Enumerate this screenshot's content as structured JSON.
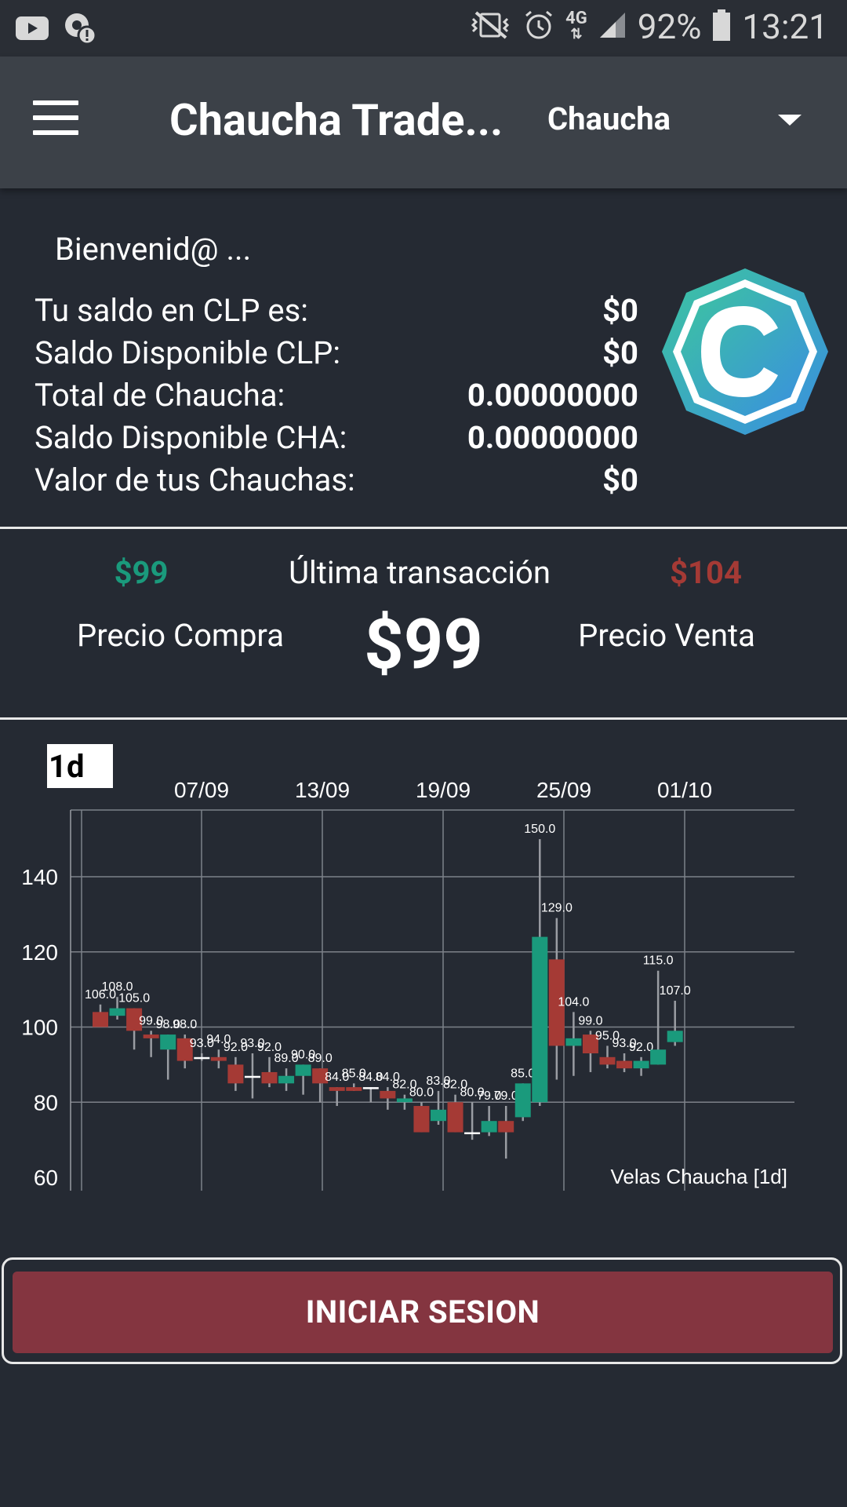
{
  "status_bar": {
    "battery": "92%",
    "time": "13:21",
    "network": "4G",
    "left_icons": [
      "youtube-icon",
      "settings-alert-icon"
    ],
    "right_icons": [
      "mute-vibrate-icon",
      "alarm-icon",
      "4g-icon",
      "signal-icon",
      "battery-icon"
    ]
  },
  "toolbar": {
    "title": "Chaucha Trade...",
    "spinner_value": "Chaucha"
  },
  "welcome": "Bienvenid@ ...",
  "balances": [
    {
      "label": "Tu saldo en CLP es:",
      "value": "$0"
    },
    {
      "label": "Saldo Disponible CLP:",
      "value": "$0"
    },
    {
      "label": "Total de Chaucha:",
      "value": "0.00000000"
    },
    {
      "label": "Saldo Disponible CHA:",
      "value": "0.00000000"
    },
    {
      "label": "Valor de tus Chauchas:",
      "value": "$0"
    }
  ],
  "prices": {
    "buy_value": "$99",
    "sell_value": "$104",
    "last_label": "Última transacción",
    "buy_label": "Precio Compra",
    "sell_label": "Precio Venta",
    "last_value": "$99"
  },
  "timeframe": "1d",
  "login_button": "INICIAR SESION",
  "colors": {
    "up": "#1a9a7c",
    "down": "#a53a35",
    "background": "#252a33",
    "toolbar": "#3c4148",
    "button": "#843540"
  },
  "chart_data": {
    "type": "candlestick",
    "title": "Velas Chaucha [1d]",
    "x_ticks": [
      "07/09",
      "13/09",
      "19/09",
      "25/09",
      "01/10"
    ],
    "ylim": [
      60,
      150
    ],
    "y_ticks": [
      60,
      80,
      100,
      120,
      140
    ],
    "grid": true,
    "candles": [
      {
        "open": 104,
        "close": 100,
        "high": 106,
        "low": 100,
        "label": "106.0"
      },
      {
        "open": 103,
        "close": 105,
        "high": 108,
        "low": 102,
        "label": "108.0"
      },
      {
        "open": 105,
        "close": 99,
        "high": 105,
        "low": 94,
        "label": "105.0"
      },
      {
        "open": 98,
        "close": 97,
        "high": 99,
        "low": 92,
        "label": "99.0"
      },
      {
        "open": 94,
        "close": 98,
        "high": 98,
        "low": 86,
        "label": "98.0"
      },
      {
        "open": 97,
        "close": 91,
        "high": 98,
        "low": 89,
        "label": "98.0"
      },
      {
        "open": 92,
        "close": 92,
        "high": 93,
        "low": 91,
        "label": "93.0"
      },
      {
        "open": 92,
        "close": 91,
        "high": 94,
        "low": 89,
        "label": "94.0"
      },
      {
        "open": 90,
        "close": 85,
        "high": 92,
        "low": 83,
        "label": "92.0"
      },
      {
        "open": 87,
        "close": 87,
        "high": 93,
        "low": 81,
        "label": "93.0"
      },
      {
        "open": 88,
        "close": 85,
        "high": 92,
        "low": 84,
        "label": "92.0"
      },
      {
        "open": 85,
        "close": 87,
        "high": 89,
        "low": 83,
        "label": "89.0"
      },
      {
        "open": 87,
        "close": 90,
        "high": 90,
        "low": 82,
        "label": "90.0"
      },
      {
        "open": 89,
        "close": 85,
        "high": 89,
        "low": 80,
        "label": "89.0"
      },
      {
        "open": 84,
        "close": 83,
        "high": 84,
        "low": 79,
        "label": "84.0"
      },
      {
        "open": 84,
        "close": 83,
        "high": 85,
        "low": 83,
        "label": "85.0"
      },
      {
        "open": 84,
        "close": 84,
        "high": 84,
        "low": 80,
        "label": "84.0"
      },
      {
        "open": 83,
        "close": 81,
        "high": 84,
        "low": 78,
        "label": "84.0"
      },
      {
        "open": 80,
        "close": 81,
        "high": 82,
        "low": 78,
        "label": "82.0"
      },
      {
        "open": 79,
        "close": 72,
        "high": 80,
        "low": 72,
        "label": "80.0"
      },
      {
        "open": 75,
        "close": 78,
        "high": 83,
        "low": 74,
        "label": "83.0"
      },
      {
        "open": 80,
        "close": 72,
        "high": 82,
        "low": 72,
        "label": "82.0"
      },
      {
        "open": 72,
        "close": 72,
        "high": 80,
        "low": 70,
        "label": "80.0"
      },
      {
        "open": 72,
        "close": 75,
        "high": 79,
        "low": 71,
        "label": "79.0"
      },
      {
        "open": 75,
        "close": 72,
        "high": 79,
        "low": 65,
        "label": "79.0"
      },
      {
        "open": 76,
        "close": 85,
        "high": 85,
        "low": 75,
        "label": "85.0"
      },
      {
        "open": 80,
        "close": 124,
        "high": 150,
        "low": 79,
        "label": "150.0"
      },
      {
        "open": 118,
        "close": 95,
        "high": 129,
        "low": 86,
        "label": "129.0"
      },
      {
        "open": 95,
        "close": 97,
        "high": 104,
        "low": 87,
        "label": "104.0"
      },
      {
        "open": 98,
        "close": 93,
        "high": 99,
        "low": 88,
        "label": "99.0"
      },
      {
        "open": 92,
        "close": 90,
        "high": 95,
        "low": 89,
        "label": "95.0"
      },
      {
        "open": 91,
        "close": 89,
        "high": 93,
        "low": 88,
        "label": "93.0"
      },
      {
        "open": 89,
        "close": 91,
        "high": 92,
        "low": 87,
        "label": "92.0"
      },
      {
        "open": 90,
        "close": 94,
        "high": 115,
        "low": 90,
        "label": "115.0"
      },
      {
        "open": 96,
        "close": 99,
        "high": 107,
        "low": 95,
        "label": "107.0"
      }
    ]
  }
}
